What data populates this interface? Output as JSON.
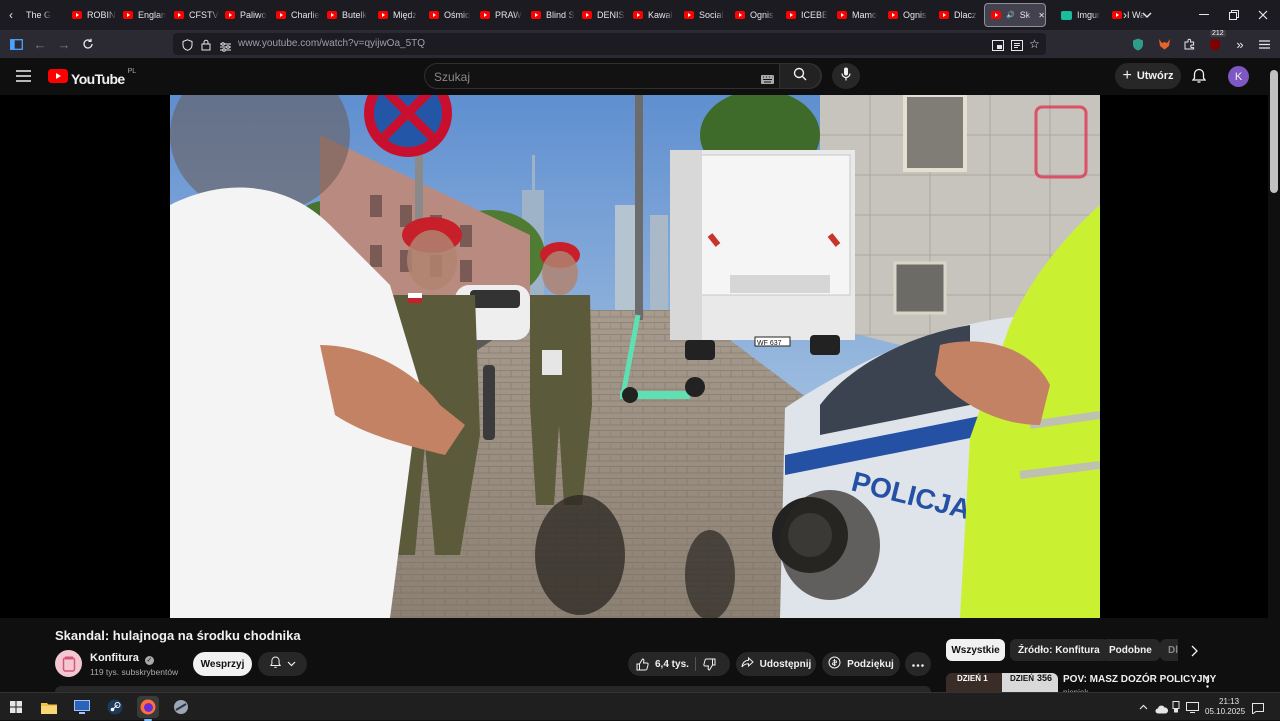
{
  "browser": {
    "tabs": [
      {
        "label": "The G",
        "favicon": "page-icon"
      },
      {
        "label": "ROBIN",
        "favicon": "youtube-icon"
      },
      {
        "label": "Englan",
        "favicon": "youtube-icon"
      },
      {
        "label": "CFSTV",
        "favicon": "youtube-icon"
      },
      {
        "label": "Paliwo",
        "favicon": "youtube-icon"
      },
      {
        "label": "Charlie",
        "favicon": "youtube-icon"
      },
      {
        "label": "Butelk",
        "favicon": "youtube-icon"
      },
      {
        "label": "Międz",
        "favicon": "youtube-icon"
      },
      {
        "label": "Ośmio",
        "favicon": "youtube-icon"
      },
      {
        "label": "PRAW",
        "favicon": "youtube-icon"
      },
      {
        "label": "Blind S",
        "favicon": "youtube-icon"
      },
      {
        "label": "DENIS",
        "favicon": "youtube-icon"
      },
      {
        "label": "Kawał",
        "favicon": "youtube-icon"
      },
      {
        "label": "Social",
        "favicon": "youtube-icon"
      },
      {
        "label": "Ognis",
        "favicon": "youtube-icon"
      },
      {
        "label": "ICEBE",
        "favicon": "youtube-icon"
      },
      {
        "label": "Mamo",
        "favicon": "youtube-icon"
      },
      {
        "label": "Ognis",
        "favicon": "youtube-icon"
      },
      {
        "label": "Dlacz",
        "favicon": "youtube-icon"
      },
      {
        "label": "Ska",
        "favicon": "youtube-icon",
        "active": true
      },
      {
        "label": "Imgur",
        "favicon": "imgur-icon"
      },
      {
        "label": "I Wa",
        "favicon": "youtube-icon"
      }
    ],
    "url": "www.youtube.com/watch?v=qyijwOa_5TQ",
    "extension_badge": "212"
  },
  "youtube": {
    "logo_text": "YouTube",
    "logo_region": "PL",
    "search_placeholder": "Szukaj",
    "create_label": "Utwórz",
    "avatar_letter": "K"
  },
  "video": {
    "title": "Skandal: hulajnoga na środku chodnika",
    "scene_text": {
      "police_label": "POLICJA",
      "plate": "WF 637"
    }
  },
  "channel": {
    "name": "Konfitura",
    "subscribers": "119 tys. subskrybentów",
    "support_label": "Wesprzyj"
  },
  "actions": {
    "likes": "6,4 tys.",
    "share_label": "Udostępnij",
    "thanks_label": "Podziękuj"
  },
  "chips": [
    "Wszystkie",
    "Źródło: Konfitura",
    "Podobne",
    "Dla"
  ],
  "recommended": {
    "title": "POV: MASZ DOZÓR POLICYJNY",
    "thumb_left_text": "DZIEŃ 1",
    "thumb_right_text": "DZIEŃ",
    "thumb_right_number": "356",
    "channel_partial": "pieniek"
  },
  "taskbar": {
    "time": "21:13",
    "date": "05.10.2025"
  }
}
